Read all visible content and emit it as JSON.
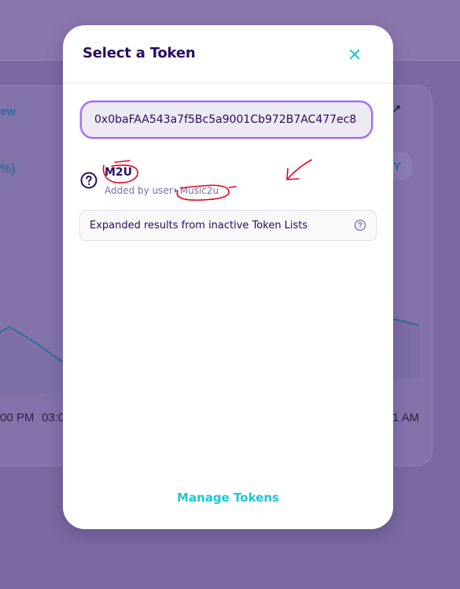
{
  "background": {
    "view_link": "ew",
    "percent_fragment": "%)",
    "button_fragment": "Y",
    "time_labels": [
      "00 PM",
      "03:0",
      "1 AM"
    ]
  },
  "modal": {
    "title": "Select a Token",
    "close_icon": "close-icon",
    "search": {
      "value": "0x0baFAA543a7f5Bc5a9001Cb972B7AC477ec8"
    },
    "token_result": {
      "icon": "help-circle-icon",
      "symbol": "M2U",
      "added_by_prefix": "Added by user",
      "list_name": "Music2u"
    },
    "expanded_results": {
      "label": "Expanded results from inactive Token Lists",
      "icon": "help-circle-icon"
    },
    "manage_tokens_label": "Manage Tokens"
  },
  "colors": {
    "accent": "#1fc7d4",
    "text_primary": "#280d5f",
    "text_secondary": "#7a6eaa",
    "input_border": "#9a6aff",
    "annotation_red": "#e8001c"
  }
}
